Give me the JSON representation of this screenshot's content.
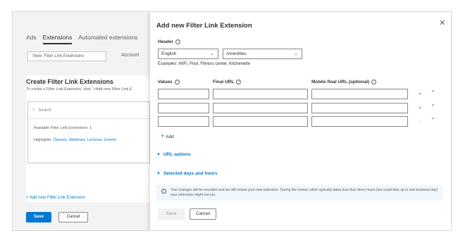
{
  "background": {
    "tabs": [
      "Ads",
      "Extensions",
      "Automated extensions"
    ],
    "view_label": "View: Filter Link Extensions",
    "account_label": "Account",
    "card_title": "Create Filter Link Extensions",
    "card_desc": "To create a Filter Link Extension, click \"+Add new Filter Link E",
    "search_placeholder": "Search",
    "available": "Available Filter Link Extensions: 1",
    "highlights_prefix": "Highlights:",
    "highlights_value": "Classes, Webinars, Lectures, Events",
    "add_new": "+ Add new Filter Link Extension",
    "save": "Save",
    "cancel": "Cancel"
  },
  "panel": {
    "title": "Add new Filter Link Extension",
    "close_glyph": "✕",
    "header_label": "Header",
    "language": "English",
    "category": "Amenities",
    "examples": "Examples: WiFi, Pool, Fitness center, Kitchenette",
    "col_values": "Values",
    "col_final": "Final URL",
    "col_mobile": "Mobile final URL (optional)",
    "add_label": "Add",
    "url_options": "URL options",
    "selected_days": "Selected days and hours",
    "notice": "Your changes will be recorded and we will review your new extension. During the review, which typically takes less than three hours (but could take up to one business day) your extension might not run.",
    "save": "Save",
    "cancel": "Cancel"
  },
  "colors": {
    "accent": "#0078d4",
    "notice_bg": "#eff6fc"
  }
}
